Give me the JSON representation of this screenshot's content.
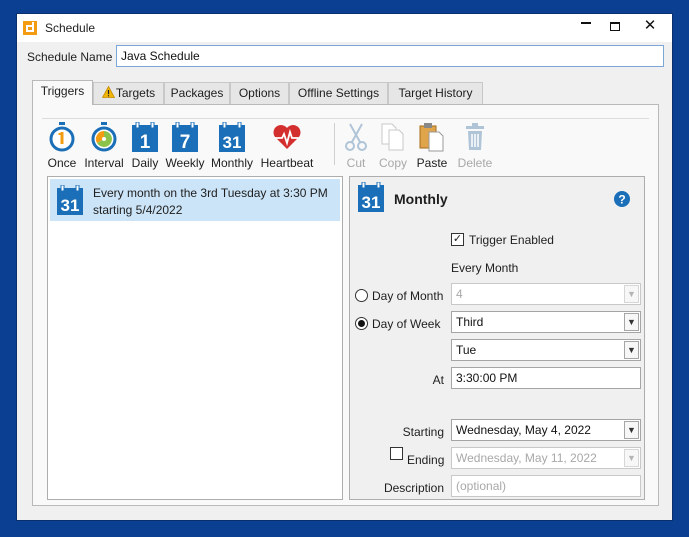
{
  "window": {
    "title": "Schedule",
    "controls": {
      "minimize": "—",
      "maximize": "",
      "close": "✕"
    }
  },
  "schedule": {
    "label": "Schedule Name",
    "value": "Java Schedule"
  },
  "tabs": [
    {
      "label": "Triggers",
      "active": true
    },
    {
      "label": "Targets",
      "warning": true
    },
    {
      "label": "Packages"
    },
    {
      "label": "Options"
    },
    {
      "label": "Offline Settings"
    },
    {
      "label": "Target History"
    }
  ],
  "toolbar": {
    "once": "Once",
    "interval": "Interval",
    "daily": "Daily",
    "weekly": "Weekly",
    "monthly": "Monthly",
    "heartbeat": "Heartbeat",
    "cut": "Cut",
    "copy": "Copy",
    "paste": "Paste",
    "delete": "Delete",
    "daily_icon_num": "1",
    "weekly_icon_num": "7",
    "monthly_icon_num": "31"
  },
  "triggers": [
    {
      "line1": "Every month on the 3rd Tuesday at 3:30 PM",
      "line2": "starting 5/4/2022",
      "icon_num": "31"
    }
  ],
  "detail": {
    "title": "Monthly",
    "icon_num": "31",
    "help_icon": "?",
    "trigger_enabled_label": "Trigger Enabled",
    "trigger_enabled": true,
    "every_month_text": "Every Month",
    "day_of_month_label": "Day of Month",
    "day_of_month_value": "4",
    "day_of_week_label": "Day of Week",
    "week_ordinal_value": "Third",
    "weekday_value": "Tue",
    "at_label": "At",
    "at_value": "3:30:00 PM",
    "starting_label": "Starting",
    "starting_value": "Wednesday,  May  4, 2022",
    "ending_label": "Ending",
    "ending_value": "Wednesday,  May 11, 2022",
    "description_label": "Description",
    "description_placeholder": "(optional)",
    "check_mark": "✓"
  },
  "colors": {
    "desktop": "#0b3f91",
    "accent_blue": "#1a6fb8",
    "heart_red": "#d32f2f",
    "selection": "#cce4f7",
    "warning": "#f2b705"
  }
}
